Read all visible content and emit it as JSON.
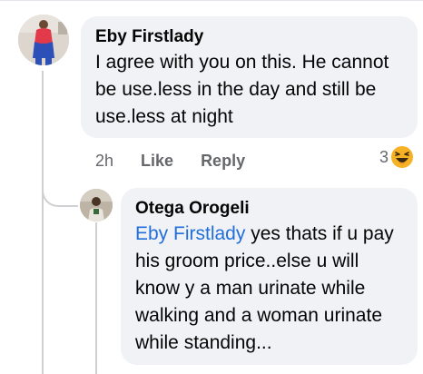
{
  "comment": {
    "author": "Eby Firstlady",
    "text": "I agree with you on this. He cannot be use.less in the day and still be use.less at night",
    "time": "2h",
    "like_label": "Like",
    "reply_label": "Reply",
    "reaction_count": "3",
    "reaction_icon": "haha-emoji-icon"
  },
  "reply": {
    "author": "Otega Orogeli",
    "mention": "Eby Firstlady",
    "text": " yes thats if u pay his groom price..else u will know y a man urinate while walking and a woman urinate while standing..."
  },
  "colors": {
    "bubble": "#f0f2f5",
    "mention": "#216fdb",
    "meta": "#65676b",
    "haha": "#f7b125"
  }
}
